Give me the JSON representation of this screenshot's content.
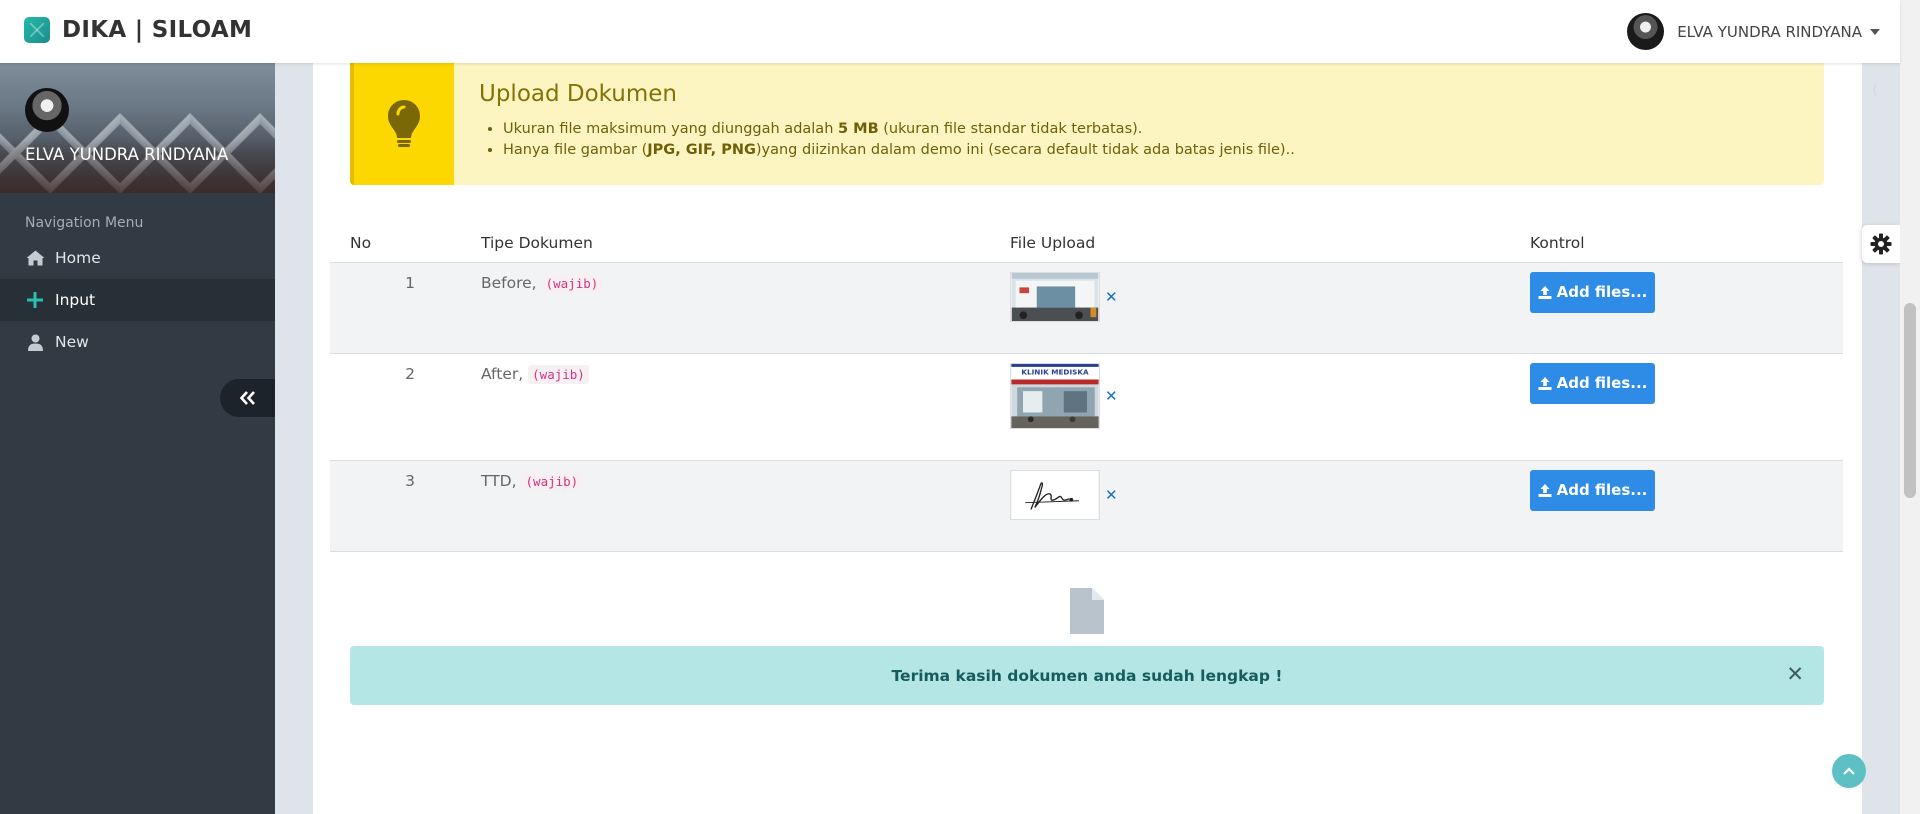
{
  "app": {
    "brand": "DIKA | SILOAM"
  },
  "user": {
    "name": "ELVA YUNDRA RINDYANA"
  },
  "sidebar": {
    "profile_name": "ELVA YUNDRA RINDYANA",
    "nav_header": "Navigation Menu",
    "items": [
      {
        "label": "Home",
        "icon": "home-icon"
      },
      {
        "label": "Input",
        "icon": "plus-icon",
        "active": true
      },
      {
        "label": "New",
        "icon": "user-icon"
      }
    ]
  },
  "callout": {
    "title": "Upload Dokumen",
    "line1_pre": "Ukuran file maksimum yang diunggah adalah ",
    "line1_bold": "5 MB",
    "line1_post": " (ukuran file standar tidak terbatas).",
    "line2_pre": "Hanya file gambar (",
    "line2_bold": "JPG, GIF, PNG",
    "line2_post": ")yang diizinkan dalam demo ini (secara default tidak ada batas jenis file).."
  },
  "table": {
    "headers": {
      "no": "No",
      "tipe": "Tipe Dokumen",
      "file": "File Upload",
      "kontrol": "Kontrol"
    },
    "rows": [
      {
        "no": "1",
        "tipe": "Before,",
        "tag": "(wajib)",
        "button": "Add files..."
      },
      {
        "no": "2",
        "tipe": "After,",
        "tag": "(wajib)",
        "button": "Add files...",
        "thumb_text": "KLINIK MEDISKA"
      },
      {
        "no": "3",
        "tipe": "TTD,",
        "tag": "(wajib)",
        "button": "Add files..."
      }
    ]
  },
  "alert": {
    "message": "Terima kasih dokumen anda sudah lengkap !"
  },
  "colors": {
    "accent": "#2e8be6",
    "sidebar": "#323b44",
    "callout": "#fdf5c1",
    "callout_icon": "#fcd800",
    "alert": "#b3e6e5"
  }
}
